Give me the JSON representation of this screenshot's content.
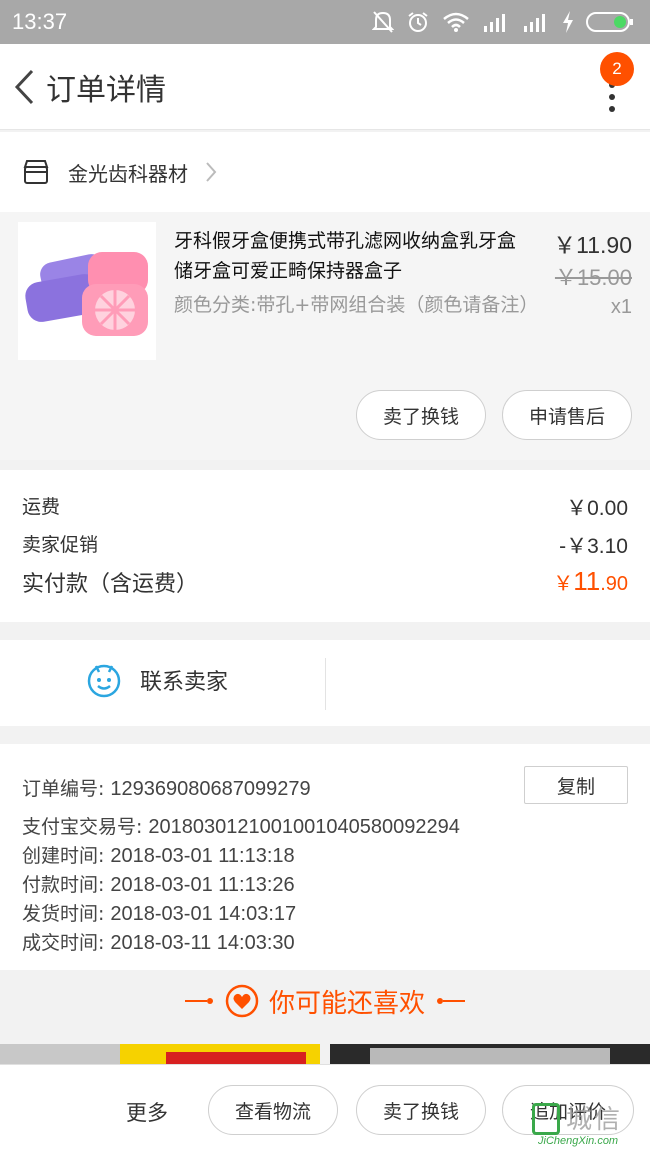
{
  "status_bar": {
    "time": "13:37"
  },
  "nav": {
    "title": "订单详情",
    "badge_count": "2"
  },
  "shop": {
    "name": "金光齿科器材"
  },
  "item": {
    "title": "牙科假牙盒便携式带孔滤网收纳盒乳牙盒储牙盒可爱正畸保持器盒子",
    "sku": "颜色分类:带孔+带网组合装（颜色请备注）",
    "price": "￥11.90",
    "original_price": "￥15.00",
    "quantity": "x1",
    "buttons": {
      "sell": "卖了换钱",
      "after_sale": "申请售后"
    }
  },
  "fees": {
    "shipping_label": "运费",
    "shipping_value": "￥0.00",
    "promo_label": "卖家促销",
    "promo_value": "-￥3.10",
    "total_label": "实付款（含运费）",
    "total_symbol": "￥",
    "total_int": "11",
    "total_dec": ".90"
  },
  "contact": {
    "label": "联系卖家"
  },
  "order_info": {
    "copy_label": "复制",
    "order_no_label": "订单编号:",
    "order_no": "129369080687099279",
    "alipay_label": "支付宝交易号:",
    "alipay_no": "2018030121001001040580092294",
    "created_label": "创建时间:",
    "created": "2018-03-01 11:13:18",
    "paid_label": "付款时间:",
    "paid": "2018-03-01 11:13:26",
    "shipped_label": "发货时间:",
    "shipped": "2018-03-01 14:03:17",
    "closed_label": "成交时间:",
    "closed": "2018-03-11 14:03:30"
  },
  "recommend": {
    "title": "你可能还喜欢"
  },
  "bottom_bar": {
    "more": "更多",
    "logistics": "查看物流",
    "sell": "卖了换钱",
    "review": "追加评价"
  },
  "watermark": {
    "text": "城信",
    "url": "JiChengXin.com"
  },
  "colors": {
    "accent": "#ff5000",
    "status_bar": "#a8a8a8",
    "contact_icon": "#2ba6e0"
  }
}
